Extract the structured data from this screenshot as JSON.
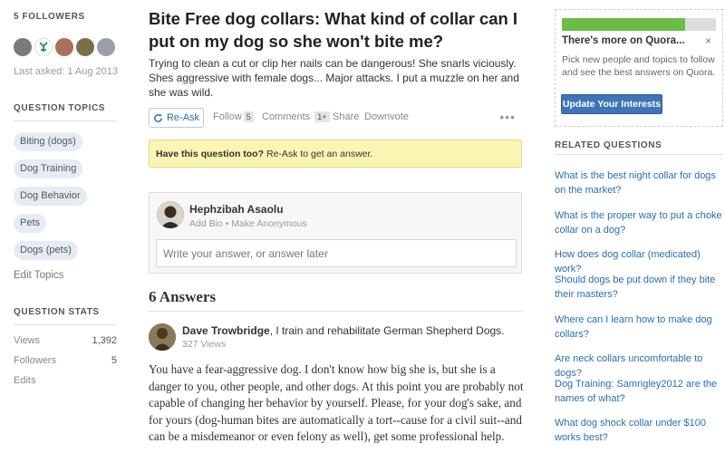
{
  "sidebar": {
    "followers_heading": "5 FOLLOWERS",
    "followers": [
      {
        "avatar": "follower-1",
        "color": "#7a7a7a"
      },
      {
        "avatar": "follower-2",
        "color": "#4a9d5a"
      },
      {
        "avatar": "follower-3",
        "color": "#a86f5b"
      },
      {
        "avatar": "follower-4",
        "color": "#7b6f4a"
      },
      {
        "avatar": "follower-5",
        "color": "#9aa0a8"
      }
    ],
    "last_asked": "Last asked: 1 Aug 2013",
    "topics_heading": "QUESTION TOPICS",
    "topics": [
      "Biting (dogs)",
      "Dog Training",
      "Dog Behavior",
      "Pets",
      "Dogs (pets)"
    ],
    "edit_topics": "Edit Topics",
    "stats_heading": "QUESTION STATS",
    "stats": [
      {
        "label": "Views",
        "value": "1,392"
      },
      {
        "label": "Followers",
        "value": "5"
      },
      {
        "label": "Edits",
        "value": ""
      }
    ]
  },
  "question": {
    "title": "Bite Free dog collars: What kind of collar can I put on my dog so she won't bite me?",
    "details": "Trying to clean a cut or clip her nails can be dangerous! She snarls viciously. Shes aggressive with female dogs... Major attacks. I put a muzzle on her and she was wild.",
    "actions": {
      "reask": "Re-Ask",
      "follow": "Follow",
      "follow_count": "5",
      "comments": "Comments",
      "comments_count": "1+",
      "share": "Share",
      "downvote": "Downvote",
      "more": "•••"
    },
    "notice_bold": "Have this question too?",
    "notice_text": "Re-Ask to get an answer."
  },
  "answer_box": {
    "user_name": "Hephzibah Asaolu",
    "sub": "Add Bio • Make Anonymous",
    "placeholder": "Write your answer, or answer later"
  },
  "answers": {
    "heading": "6 Answers",
    "first": {
      "author": "Dave Trowbridge",
      "bio": ", I train and rehabilitate German Shepherd Dogs.",
      "views": "327 Views",
      "body": "You have a fear-aggressive dog. I don't know how big she is, but she is a danger to you, other people, and other dogs. At this point you are probably not capable of changing her behavior by yourself. Please, for your dog's sake, and for yours (dog-human bites are automatically a tort--cause for a civil suit--and can be a misdemeanor or even felony as well), get some professional help."
    }
  },
  "promo": {
    "progress": 0.8,
    "title": "There's more on Quora...",
    "close": "×",
    "text": "Pick new people and topics to follow and see the best answers on Quora.",
    "button": "Update Your Interests"
  },
  "related": {
    "heading": "RELATED QUESTIONS",
    "items": [
      "What is the best night collar for dogs on the market?",
      "What is the proper way to put a choke collar on a dog?",
      "How does dog collar (medicated) work?",
      "Should dogs be put down if they bite their masters?",
      "Where can I learn how to make dog collars?",
      "Are neck collars uncomfortable to dogs?",
      "Dog Training: Samrigley2012 are the names of what?",
      "What dog shock collar under $100 works best?"
    ]
  },
  "colors": {
    "link": "#2b6dad",
    "notice_bg": "#fbf5b4",
    "button": "#3f75b5",
    "progress": "#6cbd45"
  }
}
